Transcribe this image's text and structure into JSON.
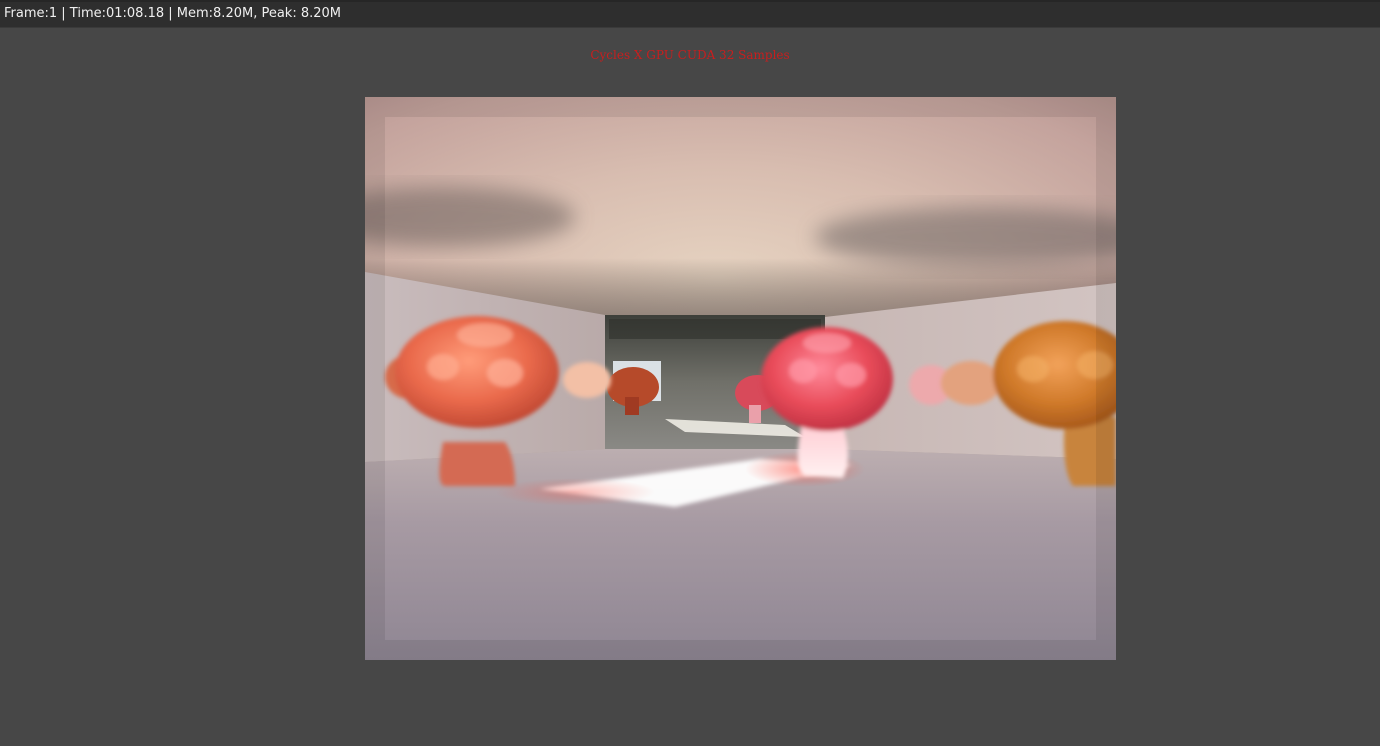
{
  "status_bar": {
    "text": "Frame:1 | Time:01:08.18 | Mem:8.20M, Peak: 8.20M"
  },
  "render": {
    "stamp": "Cycles X GPU CUDA 32 Samples"
  }
}
